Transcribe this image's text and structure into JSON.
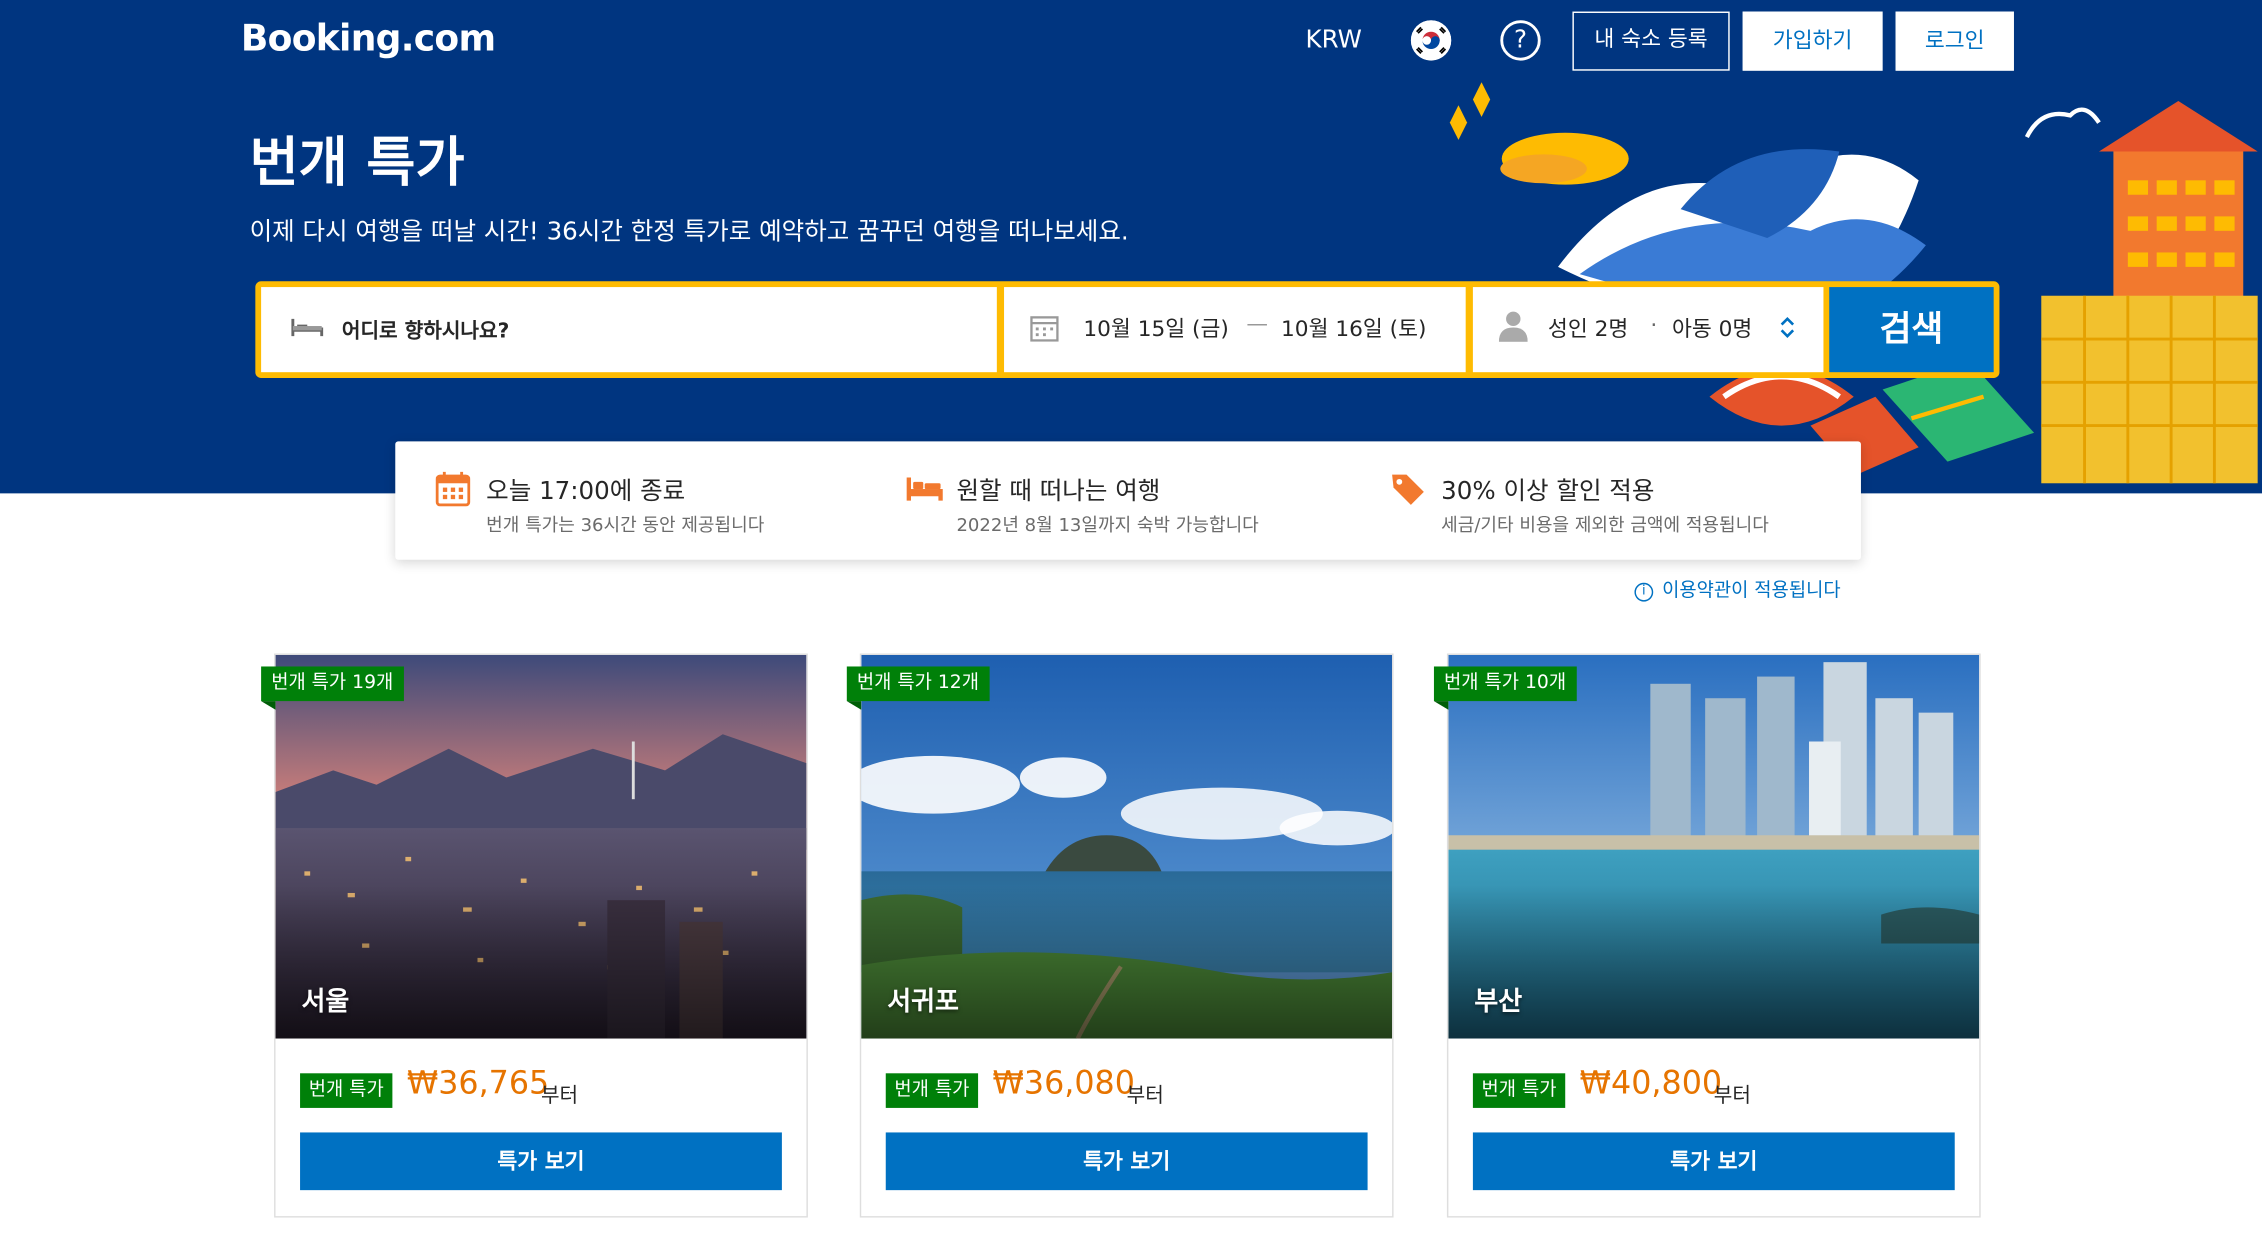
{
  "header": {
    "logo": "Booking.com",
    "currency": "KRW",
    "flag_icon": "korea-flag-icon",
    "help_icon": "question-icon",
    "list_property_label": "내 숙소 등록",
    "signup_label": "가입하기",
    "login_label": "로그인"
  },
  "hero": {
    "title": "번개 특가",
    "subtitle": "이제 다시 여행을 떠날 시간! 36시간 한정 특가로 예약하고 꿈꾸던 여행을 떠나보세요."
  },
  "search": {
    "destination_placeholder": "어디로 향하시나요?",
    "checkin": "10월 15일 (금)",
    "date_separator": "—",
    "checkout": "10월 16일 (토)",
    "adults": "성인 2명",
    "guest_separator": "·",
    "children": "아동 0명",
    "button_label": "검색"
  },
  "info": [
    {
      "icon": "calendar-icon",
      "title": "오늘 17:00에 종료",
      "desc": "번개 특가는 36시간 동안 제공됩니다"
    },
    {
      "icon": "bed-icon",
      "title": "원할 때 떠나는 여행",
      "desc": "2022년 8월 13일까지 숙박 가능합니다"
    },
    {
      "icon": "tag-icon",
      "title": "30% 이상 할인 적용",
      "desc": "세금/기타 비용을 제외한 금액에 적용됩니다"
    }
  ],
  "terms": {
    "icon": "info-icon",
    "label": "이용약관이 적용됩니다"
  },
  "cards": [
    {
      "ribbon": "번개 특가 19개",
      "city": "서울",
      "badge": "번개 특가",
      "price": "₩36,765",
      "from": "부터",
      "button": "특가 보기"
    },
    {
      "ribbon": "번개 특가 12개",
      "city": "서귀포",
      "badge": "번개 특가",
      "price": "₩36,080",
      "from": "부터",
      "button": "특가 보기"
    },
    {
      "ribbon": "번개 특가 10개",
      "city": "부산",
      "badge": "번개 특가",
      "price": "₩40,800",
      "from": "부터",
      "button": "특가 보기"
    }
  ],
  "colors": {
    "brand_blue": "#003580",
    "action_blue": "#0071c2",
    "search_yellow": "#febb02",
    "deal_green": "#008009",
    "price_orange": "#e67400"
  }
}
